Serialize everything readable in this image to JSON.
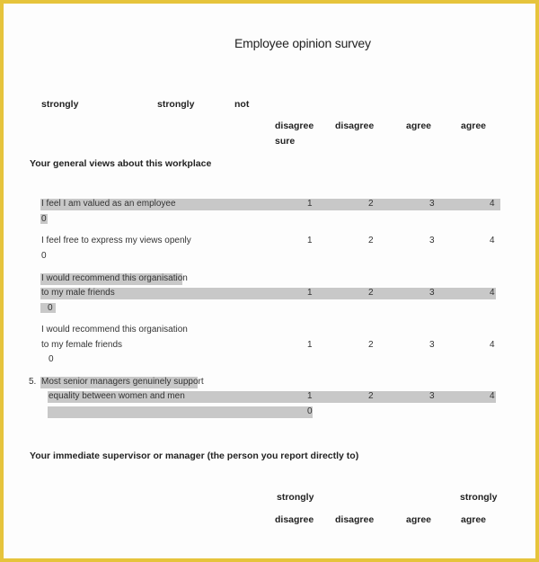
{
  "document": {
    "title": "Employee opinion survey",
    "border_color": "#e6c43c",
    "highlight_color": "#c8c8c8"
  },
  "header_top": {
    "strongly_1": "strongly",
    "strongly_2": "strongly",
    "not": "not",
    "disagree_1": "disagree",
    "sure": "sure",
    "disagree_2": "disagree",
    "agree_1": "agree",
    "agree_2": "agree"
  },
  "section1": {
    "title": "Your general views about this workplace",
    "questions": [
      {
        "lines": [
          "I feel I am valued as an employee"
        ],
        "scale": [
          "1",
          "2",
          "3",
          "4"
        ],
        "zero": "0",
        "highlighted": true
      },
      {
        "lines": [
          "I feel free to express my views openly"
        ],
        "scale": [
          "1",
          "2",
          "3",
          "4"
        ],
        "zero": "0",
        "highlighted": false
      },
      {
        "lines": [
          "I would recommend this organisation",
          "to my male friends"
        ],
        "scale": [
          "1",
          "2",
          "3",
          "4"
        ],
        "zero": "0",
        "highlighted": true
      },
      {
        "lines": [
          "I would recommend this organisation",
          "to my female friends"
        ],
        "scale": [
          "1",
          "2",
          "3",
          "4"
        ],
        "zero": "0",
        "highlighted": false
      },
      {
        "number": "5.",
        "lines": [
          "Most senior managers genuinely support",
          "equality between women and men"
        ],
        "scale": [
          "1",
          "2",
          "3",
          "4"
        ],
        "zero": "0",
        "highlighted": true
      }
    ]
  },
  "section2": {
    "title": "Your immediate supervisor or manager (the person you report directly to)",
    "header": {
      "strongly_1": "strongly",
      "strongly_2": "strongly",
      "disagree_1": "disagree",
      "disagree_2": "disagree",
      "agree_1": "agree",
      "agree_2": "agree"
    }
  }
}
